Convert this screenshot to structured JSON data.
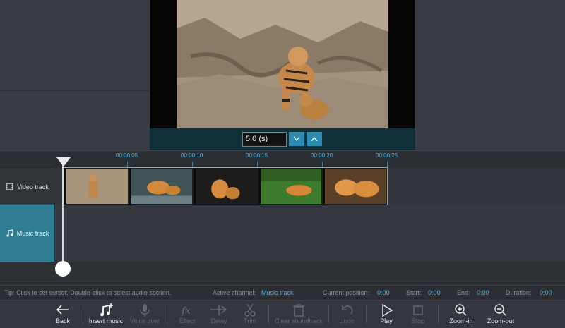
{
  "preview": {
    "duration_value": "5.0 (s)",
    "spin_down": "⌄",
    "spin_up": "⌃"
  },
  "ruler": {
    "ticks": [
      "00:00:05",
      "00:00:10",
      "00:00:15",
      "00:00:20",
      "00:00:25"
    ]
  },
  "tracks": {
    "video_label": "Video track",
    "music_label": "Music track",
    "video_icon": "film-icon",
    "music_icon": "music-note-icon"
  },
  "status": {
    "tip": "Tip: Click to set cursor. Double-click to select audio section.",
    "active_channel_label": "Active channel:",
    "active_channel_value": "Music track",
    "current_position_label": "Current position:",
    "current_position_value": "0:00",
    "start_label": "Start:",
    "start_value": "0:00",
    "end_label": "End:",
    "end_value": "0:00",
    "duration_label": "Duration:",
    "duration_value": "0:00"
  },
  "toolbar": {
    "back": "Back",
    "insert_music": "Insert music",
    "voice_over": "Voice over",
    "effect": "Effect",
    "delay": "Delay",
    "trim": "Trim",
    "clear_soundtrack": "Clear soundtrack",
    "undo": "Undo",
    "play": "Play",
    "stop": "Stop",
    "zoom_in": "Zoom-in",
    "zoom_out": "Zoom-out"
  },
  "colors": {
    "accent": "#2e7d93",
    "highlight_text": "#4fb6e1",
    "spin_button": "#2b8bb0"
  }
}
